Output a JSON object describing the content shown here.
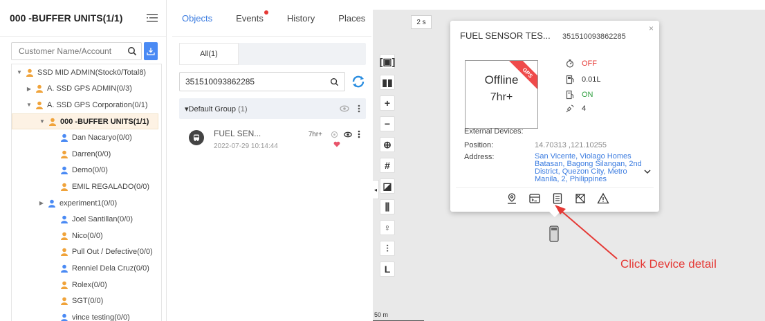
{
  "left_panel": {
    "title": "000 -BUFFER UNITS(1/1)",
    "search_placeholder": "Customer Name/Account",
    "tree": [
      {
        "label": "SSD MID ADMIN(Stock0/Total8)",
        "indent": 0,
        "expand": "down",
        "color": "#f0a33a"
      },
      {
        "label": "A. SSD GPS ADMIN(0/3)",
        "indent": 1,
        "expand": "right",
        "color": "#f0a33a"
      },
      {
        "label": "A. SSD GPS Corporation(0/1)",
        "indent": 1,
        "expand": "down",
        "color": "#f0a33a"
      },
      {
        "label": "000 -BUFFER UNITS(1/1)",
        "indent": 2,
        "expand": "down",
        "color": "#f0a33a",
        "selected": true
      },
      {
        "label": "Dan Nacaryo(0/0)",
        "indent": 3,
        "expand": "",
        "color": "#4a8af4"
      },
      {
        "label": "Darren(0/0)",
        "indent": 3,
        "expand": "",
        "color": "#f0a33a"
      },
      {
        "label": "Demo(0/0)",
        "indent": 3,
        "expand": "",
        "color": "#4a8af4"
      },
      {
        "label": "EMIL REGALADO(0/0)",
        "indent": 3,
        "expand": "",
        "color": "#f0a33a"
      },
      {
        "label": "experiment1(0/0)",
        "indent": 2,
        "expand": "right",
        "color": "#4a8af4"
      },
      {
        "label": "Joel Santillan(0/0)",
        "indent": 3,
        "expand": "",
        "color": "#4a8af4"
      },
      {
        "label": "Nico(0/0)",
        "indent": 3,
        "expand": "",
        "color": "#f0a33a"
      },
      {
        "label": "Pull Out / Defective(0/0)",
        "indent": 3,
        "expand": "",
        "color": "#f0a33a"
      },
      {
        "label": "Renniel Dela Cruz(0/0)",
        "indent": 3,
        "expand": "",
        "color": "#4a8af4"
      },
      {
        "label": "Rolex(0/0)",
        "indent": 3,
        "expand": "",
        "color": "#f0a33a"
      },
      {
        "label": "SGT(0/0)",
        "indent": 3,
        "expand": "",
        "color": "#f0a33a"
      },
      {
        "label": "vince testing(0/0)",
        "indent": 3,
        "expand": "",
        "color": "#4a8af4"
      }
    ]
  },
  "middle_panel": {
    "tabs": [
      "Objects",
      "Events",
      "History",
      "Places"
    ],
    "active_tab": "Objects",
    "subtab": "All(1)",
    "search_value": "351510093862285",
    "group": {
      "label": "▾Default Group",
      "count": "(1)"
    },
    "device": {
      "name": "FUEL SEN...",
      "time": "2022-07-29 10:14:44",
      "age": "7hr+"
    }
  },
  "map": {
    "badge": "2 s",
    "scale": "50 m",
    "toolbar": [
      "[▣]",
      "▮▮",
      "+",
      "−",
      "⊕",
      "#",
      "◪",
      "⫼",
      "♀",
      "⫶",
      "L"
    ]
  },
  "popup": {
    "title": "FUEL SENSOR TES...",
    "imei": "351510093862285",
    "status": "Offline",
    "age": "7hr+",
    "ribbon": "GPS",
    "stats": [
      {
        "icon": "engine-icon",
        "value": "OFF",
        "color": "#e53935"
      },
      {
        "icon": "fuel-icon",
        "value": "0.01L",
        "color": "#333333"
      },
      {
        "icon": "fuel-pump-icon",
        "value": "ON",
        "color": "#2e9e3e"
      },
      {
        "icon": "satellite-icon",
        "value": "4",
        "color": "#333333"
      }
    ],
    "external_devices_label": "External Devices:",
    "position_label": "Position:",
    "position_value": "14.70313 ,121.10255",
    "address_label": "Address:",
    "address_value": "San Vicente, Violago Homes Batasan, Bagong Silangan, 2nd District, Quezon City, Metro Manila, 2, Philippines",
    "close": "×"
  },
  "annotation": "Click Device detail",
  "colors": {
    "accent": "#3a7be0",
    "arrow": "#e53935"
  }
}
